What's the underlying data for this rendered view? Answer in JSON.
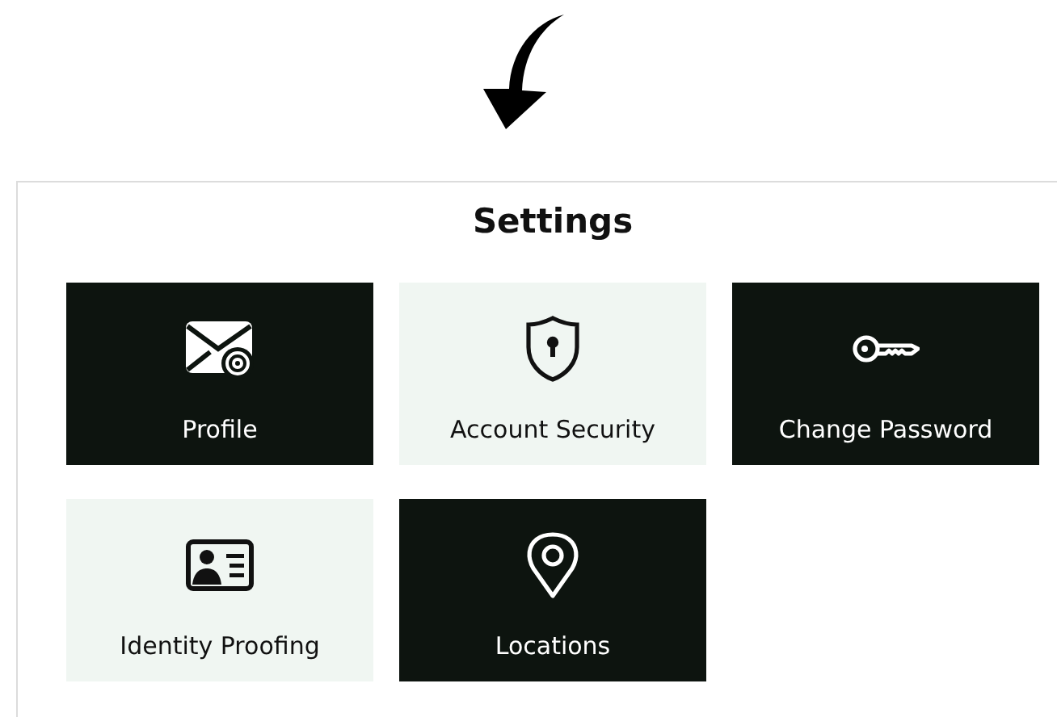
{
  "panel": {
    "title": "Settings"
  },
  "tiles": [
    {
      "label": "Profile",
      "kind": "dark"
    },
    {
      "label": "Account Security",
      "kind": "light"
    },
    {
      "label": "Change Password",
      "kind": "dark"
    },
    {
      "label": "Identity Proofing",
      "kind": "light"
    },
    {
      "label": "Locations",
      "kind": "dark"
    }
  ]
}
